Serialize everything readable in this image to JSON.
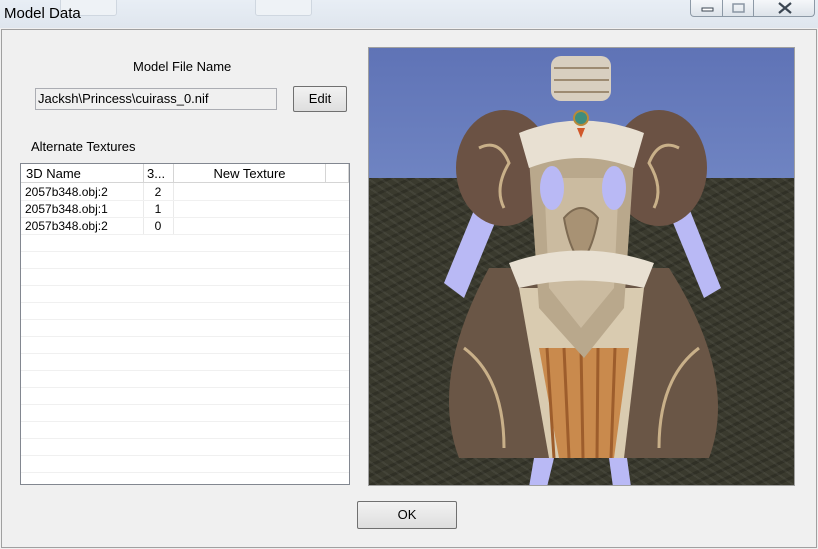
{
  "window": {
    "title": "Model Data",
    "minimize_glyph": "▬",
    "maximize_glyph": "☐",
    "close_glyph": "✕"
  },
  "model_file": {
    "heading": "Model File Name",
    "value": "Jacksh\\Princess\\cuirass_0.nif",
    "edit_label": "Edit"
  },
  "textures": {
    "heading": "Alternate Textures",
    "columns": [
      "3D Name",
      "3...",
      "New Texture"
    ],
    "rows": [
      {
        "name": "2057b348.obj:2",
        "num": "2",
        "texture": ""
      },
      {
        "name": "2057b348.obj:1",
        "num": "1",
        "texture": ""
      },
      {
        "name": "2057b348.obj:2",
        "num": "0",
        "texture": ""
      }
    ]
  },
  "buttons": {
    "ok_label": "OK"
  },
  "colors": {
    "sky": "#6f84c2",
    "ground": "#3a3a2e",
    "arm_placeholder": "#b9b9f5"
  }
}
